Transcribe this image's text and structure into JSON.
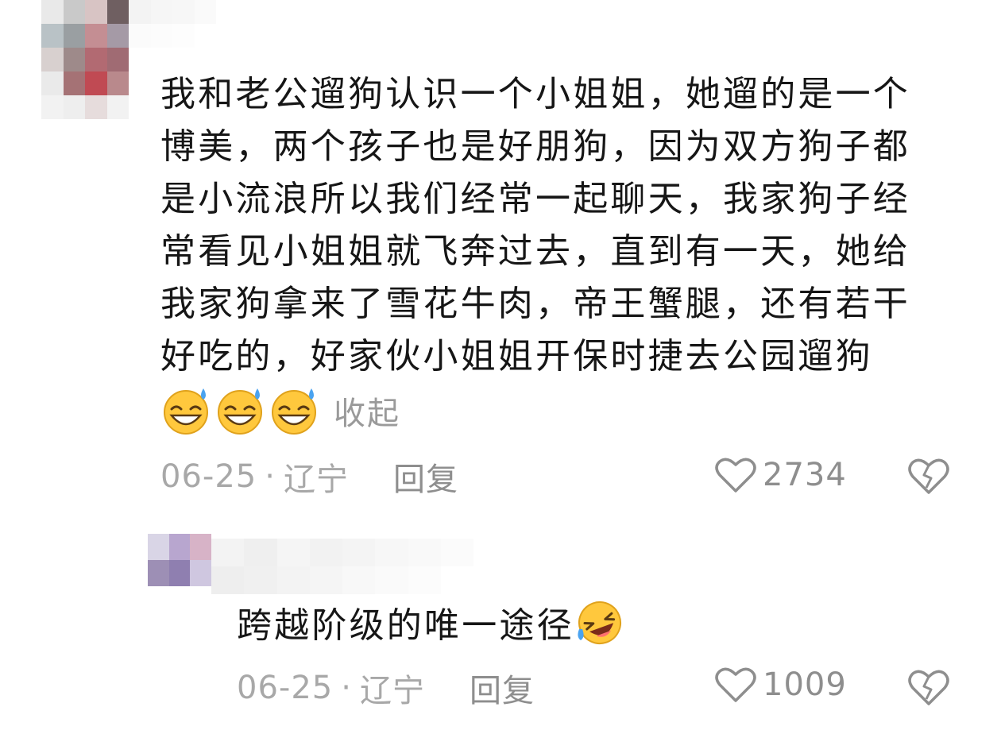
{
  "comments": [
    {
      "author_obscured": true,
      "text_lines": [
        "我和老公遛狗认识一个小姐姐，她遛的是一个",
        "博美，两个孩子也是好朋狗，因为双方狗子都",
        "是小流浪所以我们经常一起聊天，我家狗子经",
        "常看见小姐姐就飞奔过去，直到有一天，她给",
        "我家狗拿来了雪花牛肉，帝王蟹腿，还有若干",
        "好吃的，好家伙小姐姐开保时捷去公园遛狗"
      ],
      "emojis": [
        "grinning-sweat-emoji",
        "grinning-sweat-emoji",
        "grinning-sweat-emoji"
      ],
      "collapse_label": "收起",
      "date": "06-25",
      "separator": "·",
      "location": "辽宁",
      "reply_label": "回复",
      "like_count": "2734"
    },
    {
      "author_obscured": true,
      "text": "跨越阶级的唯一途径",
      "emoji": "rolling-laughing-emoji",
      "date": "06-25",
      "separator": "·",
      "location": "辽宁",
      "reply_label": "回复",
      "like_count": "1009"
    }
  ],
  "colors": {
    "text": "#161616",
    "meta": "#a8a8a8",
    "icon": "#8e8e8e",
    "emoji_face": "#ffc83d"
  },
  "mosaic": {
    "avatar_1": [
      "#e9e9e9",
      "#c9c9c9",
      "#d8c4c4",
      "#6f5f61",
      "#b9c2c6",
      "#9a9fa2",
      "#c48e93",
      "#a59aa6",
      "#d8d0cf",
      "#9e8a8a",
      "#b26a72",
      "#a06b73",
      "#eaeaea",
      "#a57275",
      "#c04a53",
      "#b9898c",
      "#f2f2f2",
      "#eeeeee",
      "#e6dcdc",
      "#f2f2f2"
    ],
    "name_1": [
      "#f3f3f3",
      "#f6f6f6",
      "#f7f7f7",
      "#fafafa",
      "#fbfbfb",
      "#fcfcfc",
      "#fdfdfd",
      "#ffffff"
    ],
    "avatar_2": [
      "#d9d5e6",
      "#b8a6cf",
      "#d7b3c7",
      "#9d8fb5",
      "#8f7fb0",
      "#cfc7e0"
    ],
    "name_2": [
      "#f3f3f3",
      "#efefef",
      "#f5f5f5",
      "#f2f2f2",
      "#f4f4f4",
      "#f7f7f7",
      "#f9f9f9",
      "#fbfbfb",
      "#eeeeee",
      "#f0f0f0",
      "#f3f3f3",
      "#f5f5f5",
      "#f8f8f8",
      "#fafafa",
      "#fcfcfc",
      "#ffffff"
    ]
  }
}
